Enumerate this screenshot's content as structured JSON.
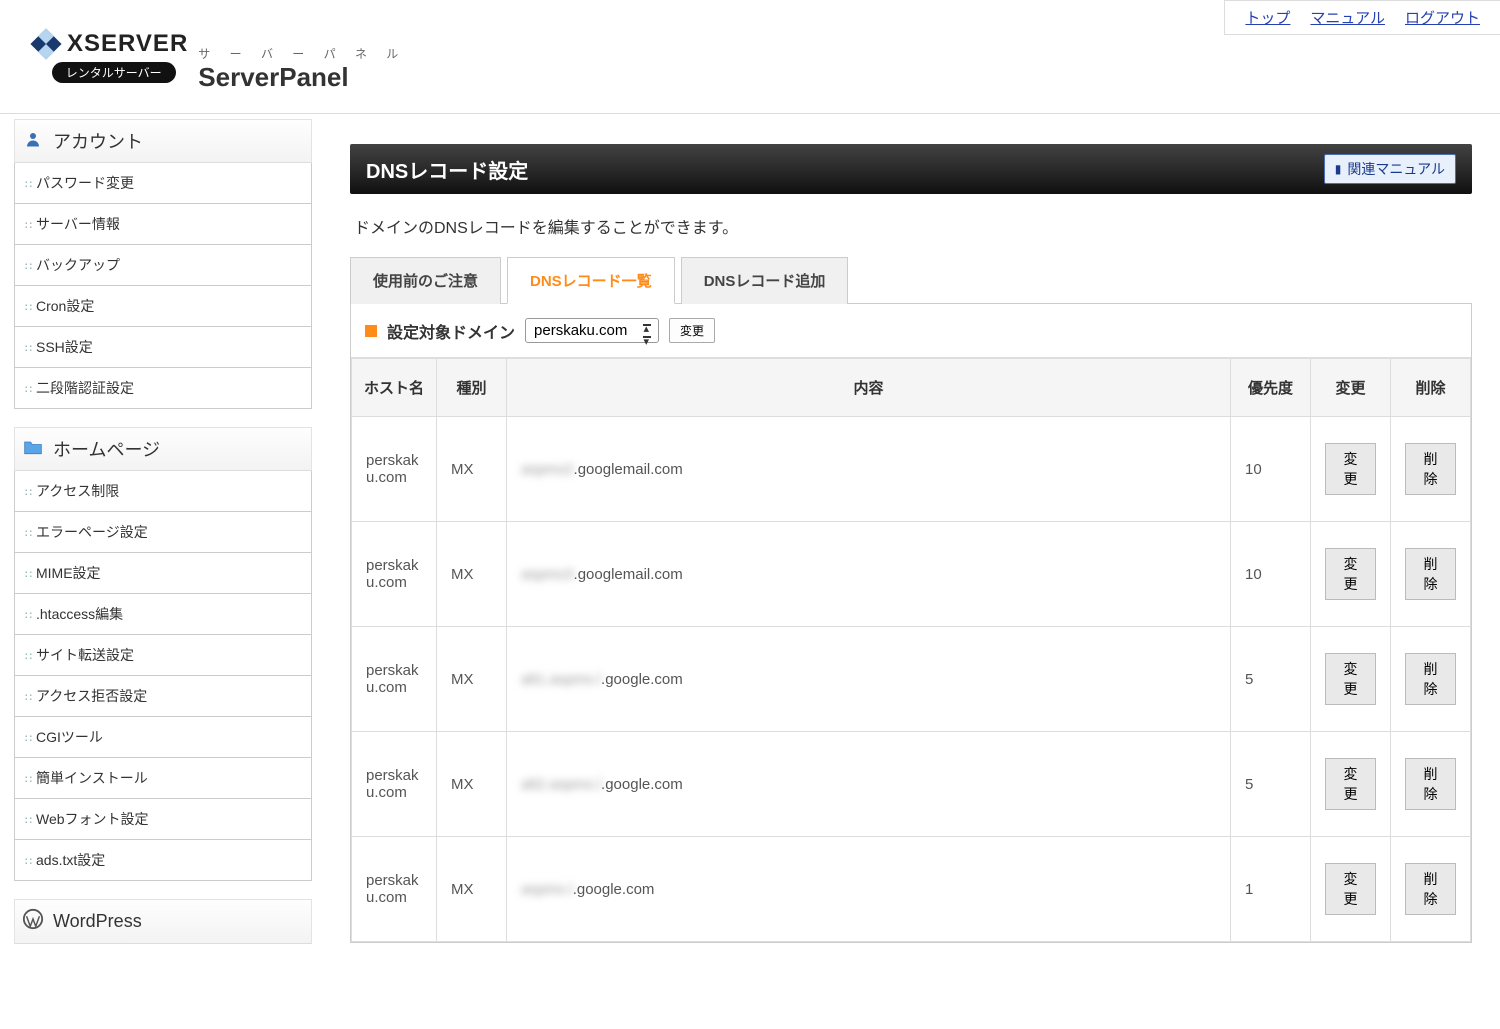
{
  "top_links": {
    "top": "トップ",
    "manual": "マニュアル",
    "logout": "ログアウト"
  },
  "brand": {
    "name": "XSERVER",
    "badge": "レンタルサーバー",
    "panel_sup": "サ ー バ ー パ ネ ル",
    "panel": "ServerPanel"
  },
  "sidebar": {
    "account": {
      "heading": "アカウント",
      "items": [
        "パスワード変更",
        "サーバー情報",
        "バックアップ",
        "Cron設定",
        "SSH設定",
        "二段階認証設定"
      ]
    },
    "homepage": {
      "heading": "ホームページ",
      "items": [
        "アクセス制限",
        "エラーページ設定",
        "MIME設定",
        ".htaccess編集",
        "サイト転送設定",
        "アクセス拒否設定",
        "CGIツール",
        "簡単インストール",
        "Webフォント設定",
        "ads.txt設定"
      ]
    },
    "wordpress": {
      "heading": "WordPress"
    }
  },
  "page": {
    "title": "DNSレコード設定",
    "manual_btn": "関連マニュアル",
    "description": "ドメインのDNSレコードを編集することができます。"
  },
  "tabs": {
    "t1": "使用前のご注意",
    "t2": "DNSレコード一覧",
    "t3": "DNSレコード追加"
  },
  "domain_row": {
    "label": "設定対象ドメイン",
    "selected": "perskaku.com",
    "change_btn": "変更"
  },
  "table": {
    "headers": {
      "host": "ホスト名",
      "type": "種別",
      "content": "内容",
      "priority": "優先度",
      "edit": "変更",
      "delete": "削除"
    },
    "edit_btn": "変更",
    "delete_btn": "削除",
    "rows": [
      {
        "host": "perskaku.com",
        "type": "MX",
        "blur": "aspmx2",
        "clear": ".googlemail.com",
        "priority": "10"
      },
      {
        "host": "perskaku.com",
        "type": "MX",
        "blur": "aspmx3",
        "clear": ".googlemail.com",
        "priority": "10"
      },
      {
        "host": "perskaku.com",
        "type": "MX",
        "blur": "alt1.aspmx.l",
        "clear": ".google.com",
        "priority": "5"
      },
      {
        "host": "perskaku.com",
        "type": "MX",
        "blur": "alt2.aspmx.l",
        "clear": ".google.com",
        "priority": "5"
      },
      {
        "host": "perskaku.com",
        "type": "MX",
        "blur": "aspmx.l",
        "clear": ".google.com",
        "priority": "1"
      }
    ]
  }
}
